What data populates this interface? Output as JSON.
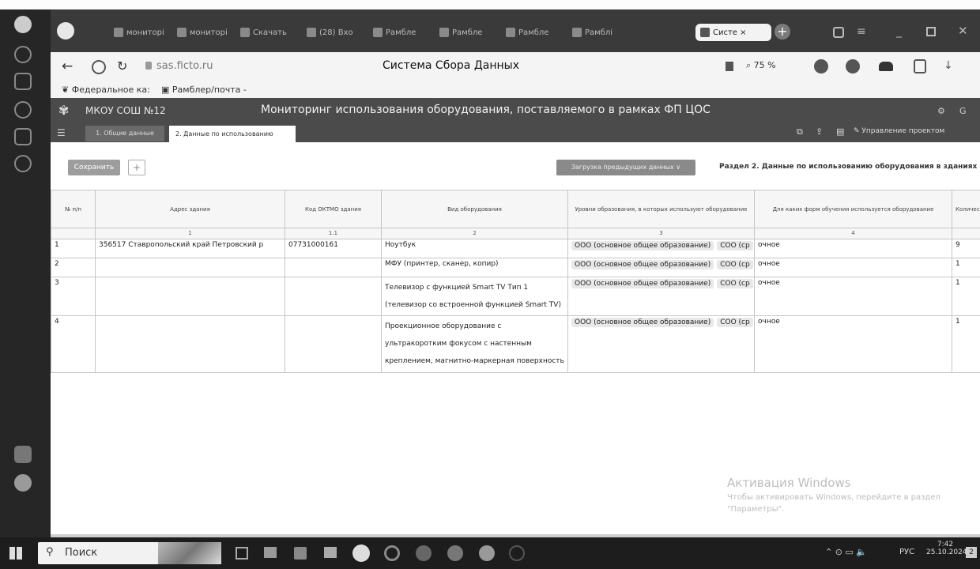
{
  "browser": {
    "tabs": [
      "мониторі",
      "мониторі",
      "Скачать",
      "(28) Вхо",
      "Рамбле",
      "Рамбле",
      "Рамбле",
      "Рамблі",
      "Систе ×"
    ],
    "url": "sas.ficto.ru",
    "page_title": "Система Сбора Данных",
    "zoom": "75 %",
    "bookmarks": [
      "Федеральное ка:",
      "Рамблер/почта -"
    ]
  },
  "app": {
    "org": "МКОУ СОШ №12",
    "title": "Мониторинг использования оборудования, поставляемого в рамках ФП ЦОС",
    "tabs": [
      "1. Общие данные",
      "2. Данные по использованию"
    ],
    "manage_label": "Управление проектом",
    "save_label": "Сохранить",
    "add_label": "+",
    "load_prev_label": "Загрузка предыдущих данных",
    "section_title": "Раздел 2. Данные по использованию оборудования в зданиях"
  },
  "table": {
    "headers": [
      "№ п/п",
      "Адрес здания",
      "Код ОКТМО здания",
      "Вид оборудования",
      "Уровни образования, в которых используют оборудование",
      "Для каких форм обучения используется оборудование",
      "Количество обор"
    ],
    "numbers": [
      "",
      "1",
      "1.1",
      "2",
      "3",
      "4",
      ""
    ],
    "rows": [
      {
        "n": "1",
        "address": "356517 Ставропольский край Петровский р",
        "oktmo": "07731000161",
        "equip": "Ноутбук",
        "lvl1": "ООО (основное общее образование)",
        "lvl2": "СОО (ср",
        "form": "очное",
        "qty": "9"
      },
      {
        "n": "2",
        "address": "",
        "oktmo": "",
        "equip": "МФУ (принтер, сканер, копир)",
        "lvl1": "ООО (основное общее образование)",
        "lvl2": "СОО (ср",
        "form": "очное",
        "qty": "1"
      },
      {
        "n": "3",
        "address": "",
        "oktmo": "",
        "equip": "Телевизор с функцией Smart TV Тип 1 (телевизор со встроенной функцией Smart TV)",
        "lvl1": "ООО (основное общее образование)",
        "lvl2": "СОО (ср",
        "form": "очное",
        "qty": "1"
      },
      {
        "n": "4",
        "address": "",
        "oktmo": "",
        "equip": "Проекционное оборудование с ультракоротким фокусом с настенным креплением, магнитно-маркерная поверхность",
        "lvl1": "ООО (основное общее образование)",
        "lvl2": "СОО (ср",
        "form": "очное",
        "qty": "1"
      }
    ]
  },
  "watermark": {
    "title": "Активация Windows",
    "text": "Чтобы активировать Windows, перейдите в раздел \"Параметры\"."
  },
  "taskbar": {
    "search": "Поиск",
    "lang": "РУС",
    "time": "7:42",
    "date": "25.10.2024",
    "badge": "2"
  }
}
